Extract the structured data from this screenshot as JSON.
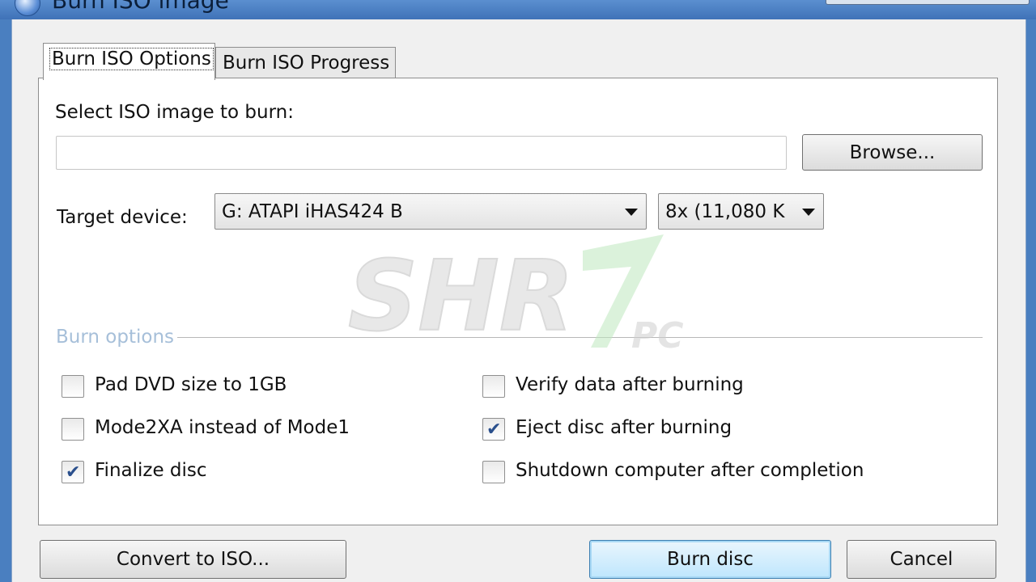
{
  "window": {
    "title": "Burn ISO image"
  },
  "tabs": [
    {
      "label": "Burn ISO Options",
      "active": true
    },
    {
      "label": "Burn ISO Progress",
      "active": false
    }
  ],
  "iso": {
    "label": "Select ISO image to burn:",
    "path_value": "",
    "browse_label": "Browse..."
  },
  "target": {
    "label": "Target device:",
    "device_value": "G: ATAPI iHAS424   B",
    "speed_value": "8x (11,080 K"
  },
  "burn_options": {
    "group_label": "Burn options",
    "left": [
      {
        "label": "Pad DVD size to 1GB",
        "checked": false
      },
      {
        "label": "Mode2XA instead of Mode1",
        "checked": false
      },
      {
        "label": "Finalize disc",
        "checked": true
      }
    ],
    "right": [
      {
        "label": "Verify data after burning",
        "checked": false
      },
      {
        "label": "Eject disc after burning",
        "checked": true
      },
      {
        "label": "Shutdown computer after completion",
        "checked": false
      }
    ]
  },
  "footer": {
    "convert_label": "Convert to ISO...",
    "burn_label": "Burn disc",
    "cancel_label": "Cancel"
  },
  "watermark": {
    "text": "SHR",
    "sub": "PC"
  },
  "colors": {
    "accent": "#3c7fb1",
    "check": "#2a4f8c",
    "group_label": "#a6bfd9"
  }
}
